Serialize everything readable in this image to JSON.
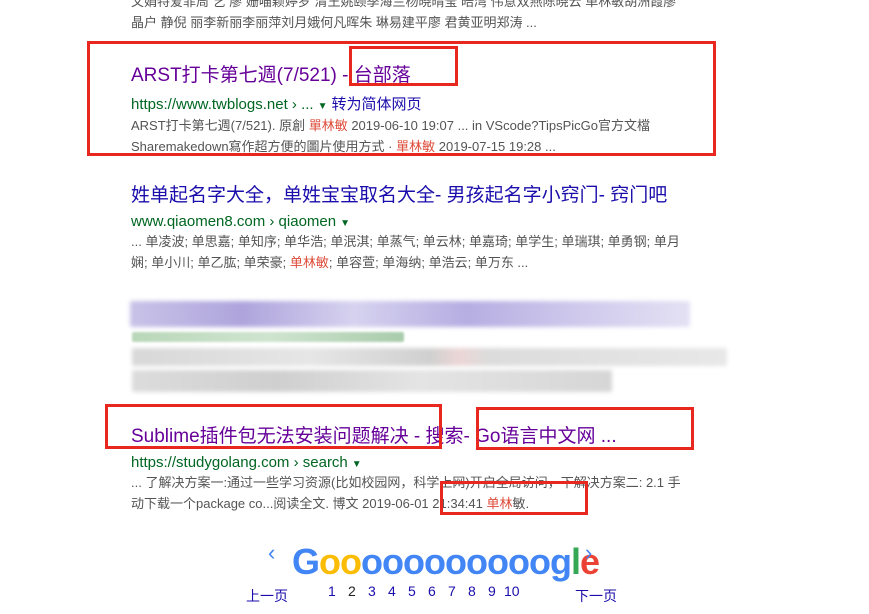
{
  "results": [
    {
      "title": "ARST打卡第七週(7/521) - 台部落",
      "url": "https://www.twblogs.net › ...",
      "translate": "转为简体网页",
      "snippet_1": "ARST打卡第七週(7/521). 原創 ",
      "snippet_1_hl": "單林敏",
      "snippet_1_tail": " 2019-06-10 19:07 ... in VScode?TipsPicGo官方文檔",
      "snippet_2": "Sharemakedown寫作超方便的圖片使用方式 · ",
      "snippet_2_hl": "單林敏",
      "snippet_2_tail": " 2019-07-15 19:28 ..."
    },
    {
      "title": "姓单起名字大全，单姓宝宝取名大全- 男孩起名字小窍门- 窍门吧",
      "url": "www.qiaomen8.com › qiaomen",
      "snippet_1": "... 单凌波; 单思嘉; 单知序; 单华浩; 单泯淇; 单蒸气; 单云林; 单嘉琦; 单学生; 单瑞琪; 单勇钢; 单月",
      "snippet_2": "娴; 单小川; 单乙肱; 单荣豪; ",
      "snippet_2_hl": "单林敏",
      "snippet_2_tail": "; 单容萱; 单海纳; 单浩云; 单万东 ..."
    },
    {
      "title": "Sublime插件包无法安装问题解决 - 搜索- Go语言中文网 ...",
      "url": "https://studygolang.com › search",
      "snippet_1": "... 了解决方案一:通过一些学习资源(比如校园网，科学上网)开启全局访问，下解决方案二: 2.1 手",
      "snippet_2": "动下载一个package co...阅读全文. 博文 2019-06-01 21:34:41 ",
      "snippet_2_hl": "单林",
      "snippet_2_tail": "敏."
    }
  ],
  "top_partial": {
    "line_1": "文娟特爱菲周 艺 廖 姗喵颖婷罗 清王姚颐季海兰杨晓晴莹 晧湾 伟意双燕陈晓云 单林敏胡洲霞廖",
    "line_2": "晶户 静倪 丽李新丽李丽萍刘月娥何凡晖朱 琳易建平廖 君黄亚明郑涛 ..."
  },
  "pagination": {
    "prev": "上一页",
    "next": "下一页",
    "pages": [
      "1",
      "2",
      "3",
      "4",
      "5",
      "6",
      "7",
      "8",
      "9",
      "10"
    ],
    "current": "2",
    "logo_letters": [
      "G",
      "o",
      "o",
      "o",
      "o",
      "o",
      "o",
      "o",
      "o",
      "o",
      "o",
      "o",
      "g",
      "l",
      "e"
    ],
    "logo_colors": [
      "#4285f4",
      "#fbbc05",
      "#fbbc05",
      "#4285f4",
      "#4285f4",
      "#4285f4",
      "#4285f4",
      "#4285f4",
      "#4285f4",
      "#4285f4",
      "#4285f4",
      "#4285f4",
      "#4285f4",
      "#34a853",
      "#ea4335"
    ],
    "arrow_left": "‹",
    "arrow_right": "›"
  }
}
